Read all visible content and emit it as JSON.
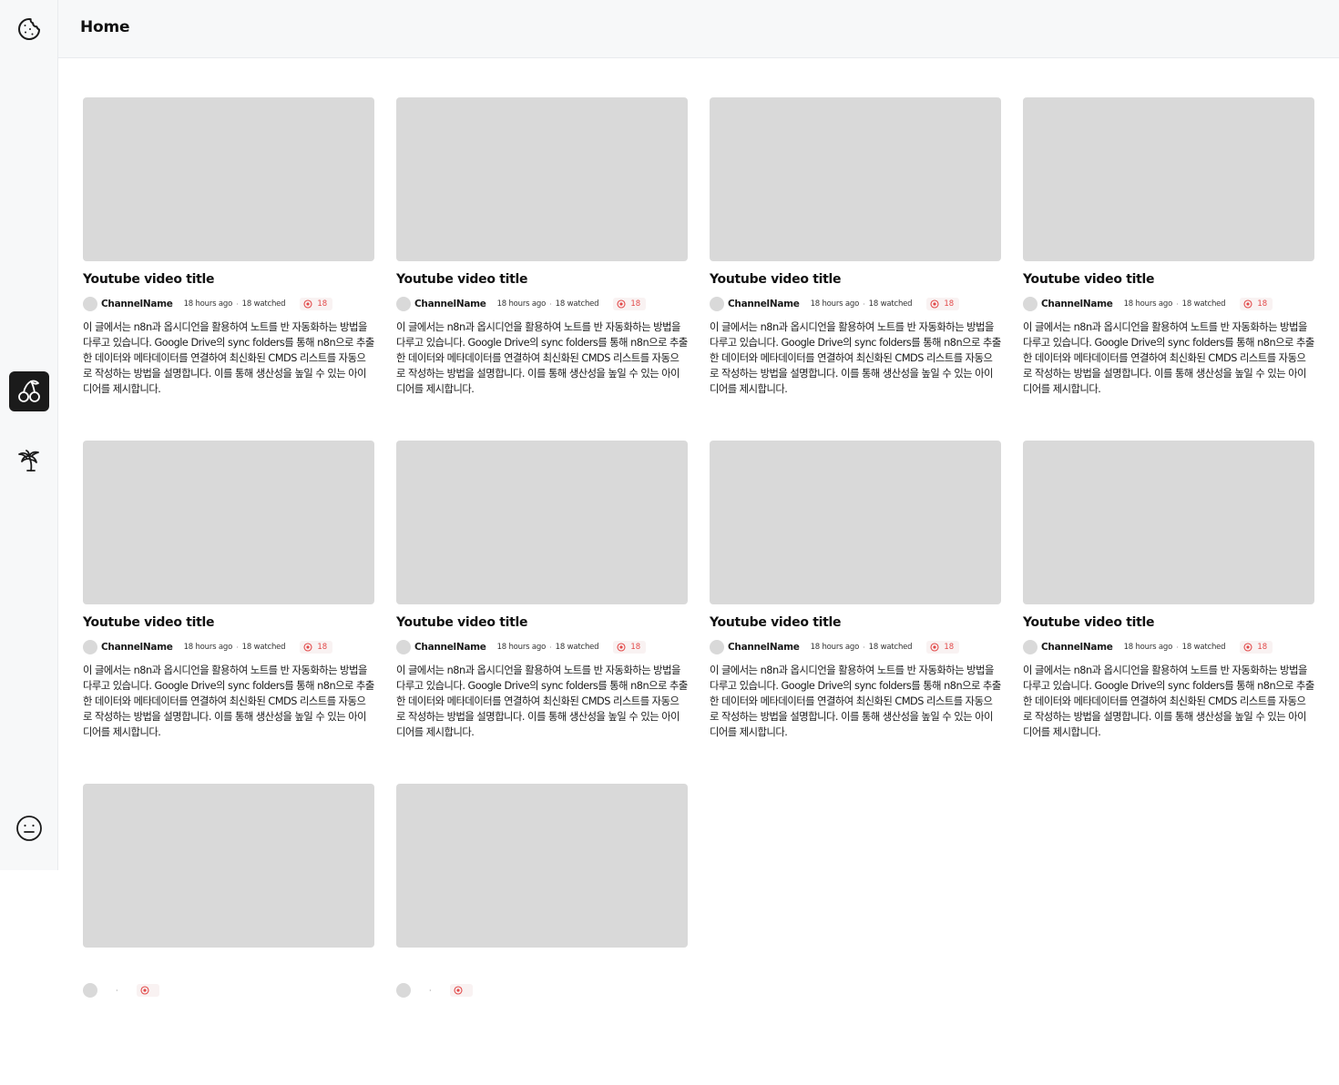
{
  "header": {
    "title": "Home"
  },
  "sidebar": {
    "items": [
      {
        "icon": "cookie-icon",
        "label": ""
      },
      {
        "icon": "cherry-icon",
        "label": "",
        "active": true
      },
      {
        "icon": "palm-tree-icon",
        "label": ""
      },
      {
        "icon": "neutral-face-icon",
        "label": ""
      }
    ]
  },
  "colors": {
    "thumbnail": "#d9d9d9",
    "active_nav": "#1b1b1b",
    "badge_text": "#e24a4a",
    "badge_bg": "#f9f2f2"
  },
  "videos": [
    {
      "title": "Youtube video title",
      "channel": "ChannelName",
      "time": "18 hours ago",
      "watched": "18 watched",
      "badge": "18",
      "description": "이 글에서는 n8n과 옵시디언을 활용하여 노트를 반 자동화하는 방법을 다루고 있습니다. Google Drive의 sync folders를 통해 n8n으로 추출한 데이터와 메타데이터를 연결하여 최신화된 CMDS 리스트를 자동으로 작성하는 방법을 설명합니다. 이를 통해 생산성을 높일 수 있는 아이디어를 제시합니다."
    },
    {
      "title": "Youtube video title",
      "channel": "ChannelName",
      "time": "18 hours ago",
      "watched": "18 watched",
      "badge": "18",
      "description": "이 글에서는 n8n과 옵시디언을 활용하여 노트를 반 자동화하는 방법을 다루고 있습니다. Google Drive의 sync folders를 통해 n8n으로 추출한 데이터와 메타데이터를 연결하여 최신화된 CMDS 리스트를 자동으로 작성하는 방법을 설명합니다. 이를 통해 생산성을 높일 수 있는 아이디어를 제시합니다."
    },
    {
      "title": "Youtube video title",
      "channel": "ChannelName",
      "time": "18 hours ago",
      "watched": "18 watched",
      "badge": "18",
      "description": "이 글에서는 n8n과 옵시디언을 활용하여 노트를 반 자동화하는 방법을 다루고 있습니다. Google Drive의 sync folders를 통해 n8n으로 추출한 데이터와 메타데이터를 연결하여 최신화된 CMDS 리스트를 자동으로 작성하는 방법을 설명합니다. 이를 통해 생산성을 높일 수 있는 아이디어를 제시합니다."
    },
    {
      "title": "Youtube video title",
      "channel": "ChannelName",
      "time": "18 hours ago",
      "watched": "18 watched",
      "badge": "18",
      "description": "이 글에서는 n8n과 옵시디언을 활용하여 노트를 반 자동화하는 방법을 다루고 있습니다. Google Drive의 sync folders를 통해 n8n으로 추출한 데이터와 메타데이터를 연결하여 최신화된 CMDS 리스트를 자동으로 작성하는 방법을 설명합니다. 이를 통해 생산성을 높일 수 있는 아이디어를 제시합니다."
    },
    {
      "title": "Youtube video title",
      "channel": "ChannelName",
      "time": "18 hours ago",
      "watched": "18 watched",
      "badge": "18",
      "description": "이 글에서는 n8n과 옵시디언을 활용하여 노트를 반 자동화하는 방법을 다루고 있습니다. Google Drive의 sync folders를 통해 n8n으로 추출한 데이터와 메타데이터를 연결하여 최신화된 CMDS 리스트를 자동으로 작성하는 방법을 설명합니다. 이를 통해 생산성을 높일 수 있는 아이디어를 제시합니다."
    },
    {
      "title": "Youtube video title",
      "channel": "ChannelName",
      "time": "18 hours ago",
      "watched": "18 watched",
      "badge": "18",
      "description": "이 글에서는 n8n과 옵시디언을 활용하여 노트를 반 자동화하는 방법을 다루고 있습니다. Google Drive의 sync folders를 통해 n8n으로 추출한 데이터와 메타데이터를 연결하여 최신화된 CMDS 리스트를 자동으로 작성하는 방법을 설명합니다. 이를 통해 생산성을 높일 수 있는 아이디어를 제시합니다."
    },
    {
      "title": "Youtube video title",
      "channel": "ChannelName",
      "time": "18 hours ago",
      "watched": "18 watched",
      "badge": "18",
      "description": "이 글에서는 n8n과 옵시디언을 활용하여 노트를 반 자동화하는 방법을 다루고 있습니다. Google Drive의 sync folders를 통해 n8n으로 추출한 데이터와 메타데이터를 연결하여 최신화된 CMDS 리스트를 자동으로 작성하는 방법을 설명합니다. 이를 통해 생산성을 높일 수 있는 아이디어를 제시합니다."
    },
    {
      "title": "Youtube video title",
      "channel": "ChannelName",
      "time": "18 hours ago",
      "watched": "18 watched",
      "badge": "18",
      "description": "이 글에서는 n8n과 옵시디언을 활용하여 노트를 반 자동화하는 방법을 다루고 있습니다. Google Drive의 sync folders를 통해 n8n으로 추출한 데이터와 메타데이터를 연결하여 최신화된 CMDS 리스트를 자동으로 작성하는 방법을 설명합니다. 이를 통해 생산성을 높일 수 있는 아이디어를 제시합니다."
    },
    {
      "title": "",
      "channel": "",
      "time": "",
      "watched": "",
      "badge": "",
      "description": ""
    },
    {
      "title": "",
      "channel": "",
      "time": "",
      "watched": "",
      "badge": "",
      "description": ""
    }
  ]
}
